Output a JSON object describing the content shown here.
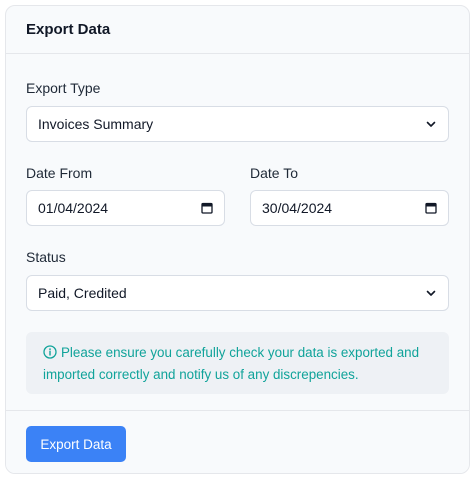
{
  "header": {
    "title": "Export Data"
  },
  "form": {
    "export_type": {
      "label": "Export Type",
      "value": "Invoices Summary"
    },
    "date_from": {
      "label": "Date From",
      "value": "01/04/2024"
    },
    "date_to": {
      "label": "Date To",
      "value": "30/04/2024"
    },
    "status": {
      "label": "Status",
      "value": "Paid, Credited"
    }
  },
  "notice": {
    "icon": "info-icon",
    "text": "Please ensure you carefully check your data is exported and imported correctly and notify us of any discrepencies."
  },
  "footer": {
    "export_button_label": "Export Data"
  },
  "colors": {
    "accent": "#3b82f6",
    "notice_text": "#10a39a",
    "notice_bg": "#eef1f5"
  }
}
